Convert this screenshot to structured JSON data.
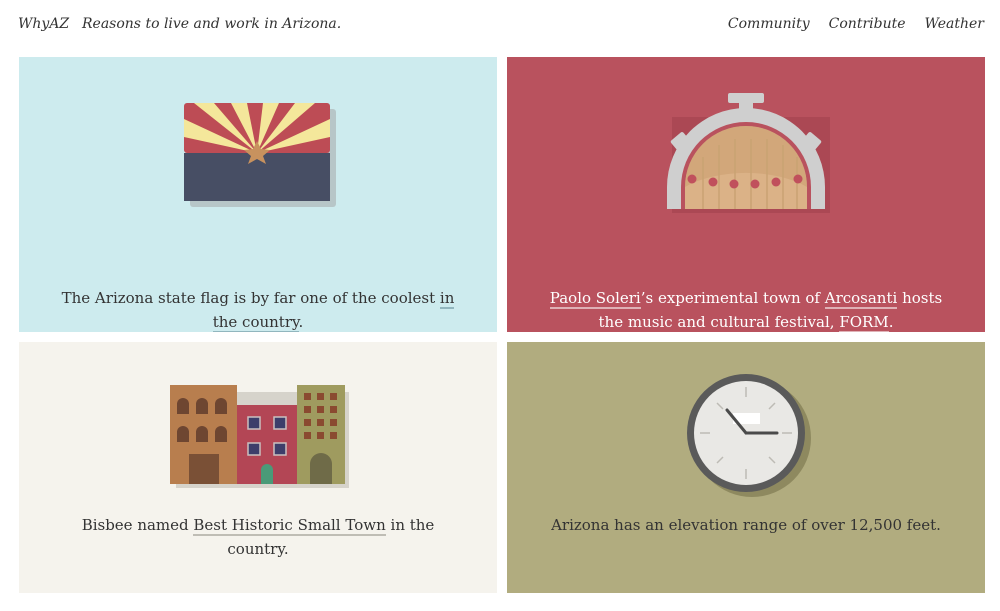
{
  "header": {
    "brand": "WhyAZ",
    "tagline": "Reasons to live and work in Arizona.",
    "nav": [
      "Community",
      "Contribute",
      "Weather"
    ]
  },
  "cards": [
    {
      "illustration": "arizona-flag-icon",
      "background": "#cdebee",
      "parts": [
        {
          "text": "The Arizona state flag is by far one of the coolest "
        },
        {
          "text": "in the country",
          "link": true
        },
        {
          "text": "."
        }
      ]
    },
    {
      "illustration": "arcosanti-bell-icon",
      "background": "#b9525e",
      "parts": [
        {
          "text": "Paolo Soleri",
          "link": true
        },
        {
          "text": "’s experimental town of "
        },
        {
          "text": "Arcosanti",
          "link": true
        },
        {
          "text": " hosts the music and cultural festival, "
        },
        {
          "text": "FORM",
          "link": true
        },
        {
          "text": "."
        }
      ]
    },
    {
      "illustration": "historic-buildings-icon",
      "background": "#f5f3ed",
      "parts": [
        {
          "text": "Bisbee named "
        },
        {
          "text": "Best Historic Small Town",
          "link": true
        },
        {
          "text": " in the country."
        }
      ]
    },
    {
      "illustration": "clock-icon",
      "background": "#b1ac7f",
      "parts": [
        {
          "text": "Arizona has an elevation range of over 12,500 feet."
        }
      ]
    }
  ]
}
